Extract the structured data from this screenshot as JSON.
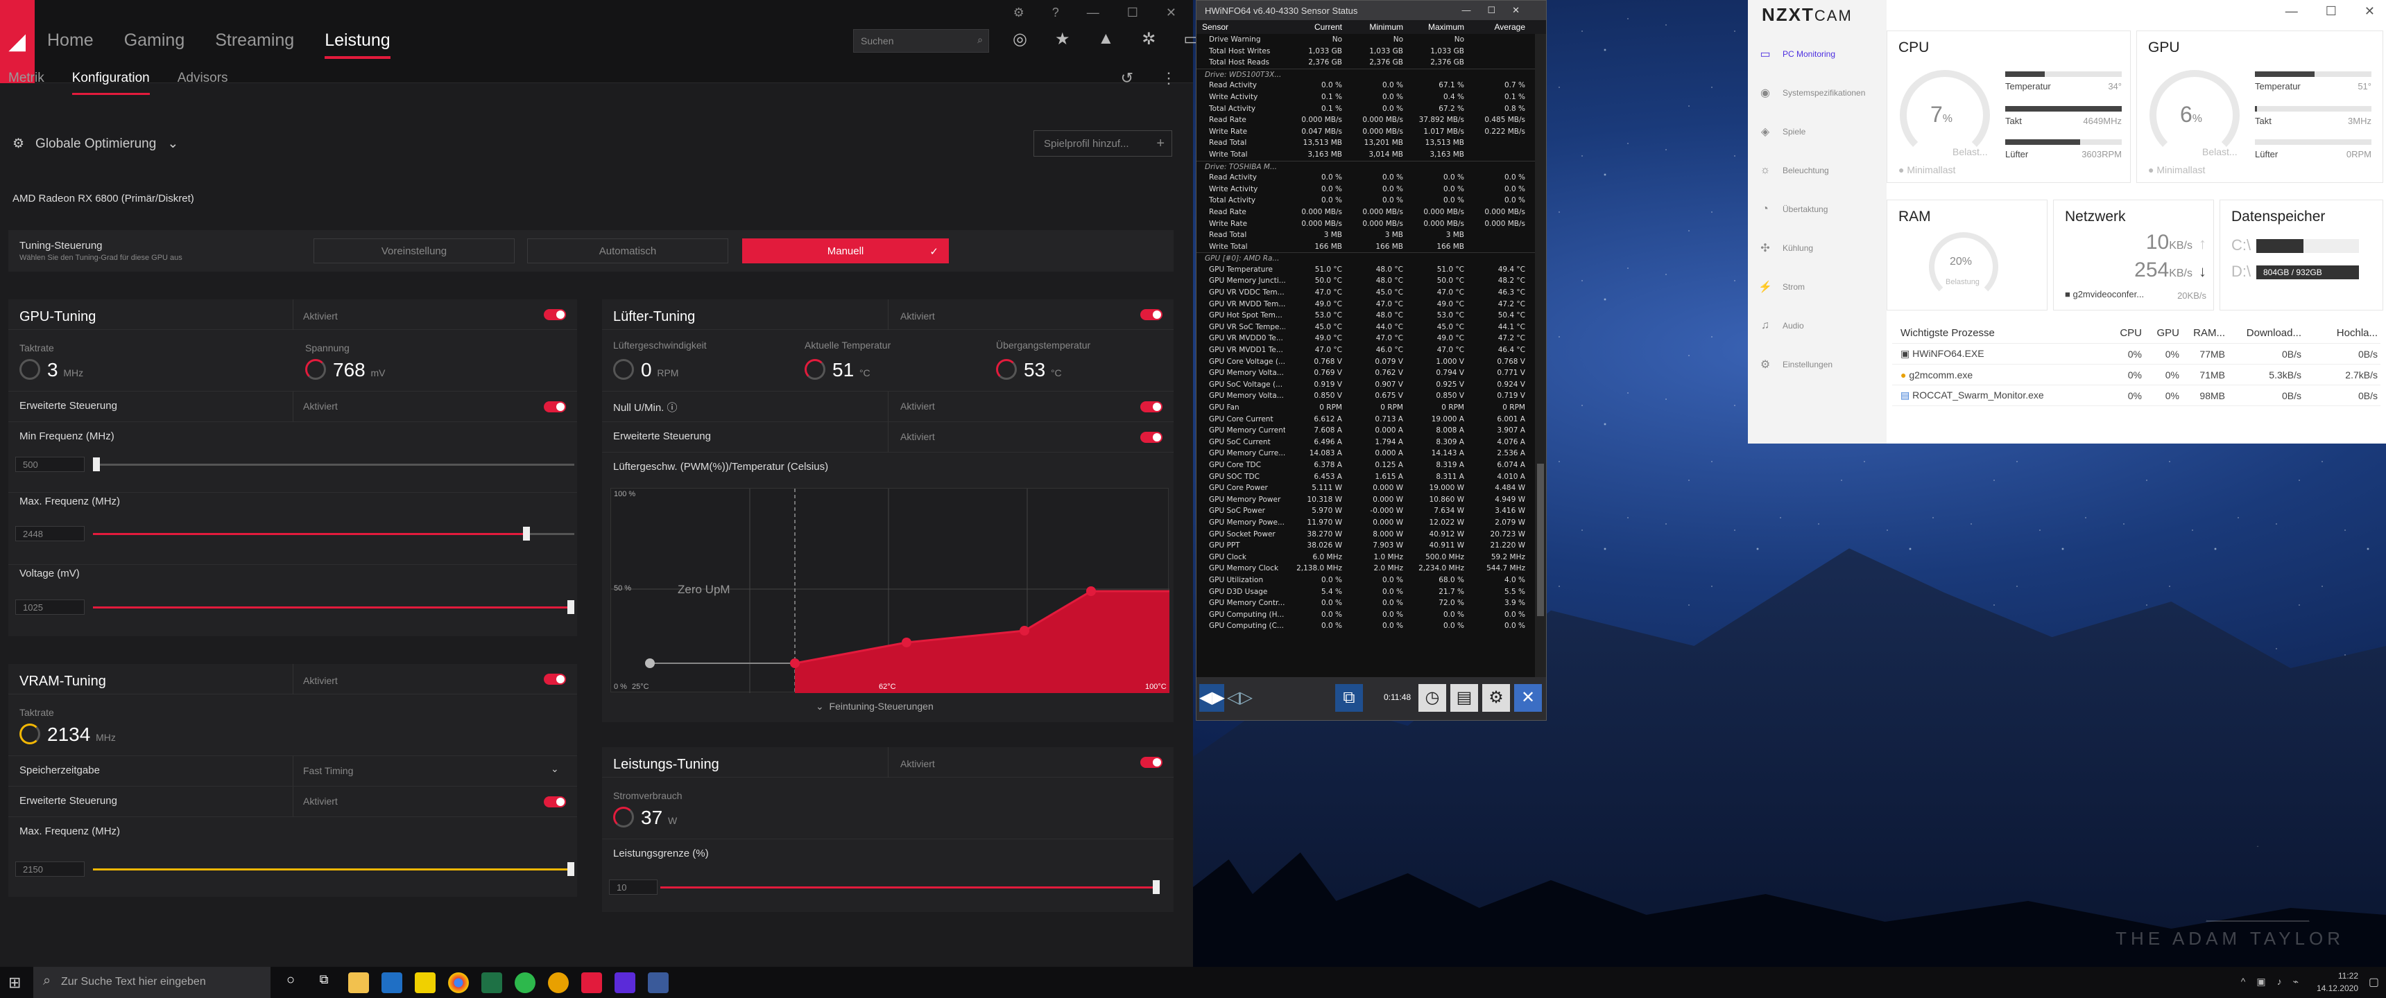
{
  "amd": {
    "nav": [
      "Home",
      "Gaming",
      "Streaming",
      "Leistung"
    ],
    "nav_active": "Leistung",
    "search_placeholder": "Suchen",
    "subnav": [
      "Metrik",
      "Konfiguration",
      "Advisors"
    ],
    "opt_label": "Globale Optimierung",
    "spielprofil": "Spielprofil hinzuf...",
    "gpu_name": "AMD Radeon RX 6800 (Primär/Diskret)",
    "tuning": {
      "title": "Tuning-Steuerung",
      "sub": "Wählen Sie den Tuning-Grad für diese GPU aus",
      "opts": [
        "Voreinstellung",
        "Automatisch",
        "Manuell"
      ]
    },
    "gpu": {
      "title": "GPU-Tuning",
      "status": "Aktiviert",
      "taktrate_label": "Taktrate",
      "taktrate": "3",
      "taktrate_unit": "MHz",
      "spannung_label": "Spannung",
      "spannung": "768",
      "spannung_unit": "mV",
      "erw": "Erweiterte Steuerung",
      "erw_status": "Aktiviert",
      "min_label": "Min Frequenz (MHz)",
      "min_val": "500",
      "max_label": "Max. Frequenz (MHz)",
      "max_val": "2448",
      "volt_label": "Voltage (mV)",
      "volt_val": "1025"
    },
    "vram": {
      "title": "VRAM-Tuning",
      "status": "Aktiviert",
      "taktrate_label": "Taktrate",
      "taktrate": "2134",
      "taktrate_unit": "MHz",
      "zeit_label": "Speicherzeitgabe",
      "zeit_val": "Fast Timing",
      "erw": "Erweiterte Steuerung",
      "erw_status": "Aktiviert",
      "max_label": "Max. Frequenz (MHz)",
      "max_val": "2150"
    },
    "fan": {
      "title": "Lüfter-Tuning",
      "status": "Aktiviert",
      "speed_label": "Lüftergeschwindigkeit",
      "speed": "0",
      "speed_unit": "RPM",
      "temp_label": "Aktuelle Temperatur",
      "temp": "51",
      "temp_unit": "°C",
      "jt_label": "Übergangstemperatur",
      "jt": "53",
      "jt_unit": "°C",
      "null_label": "Null U/Min.",
      "null_status": "Aktiviert",
      "erw": "Erweiterte Steuerung",
      "erw_status": "Aktiviert",
      "chart_title": "Lüftergeschw. (PWM(%))/Temperatur (Celsius)",
      "y100": "100 %",
      "y50": "50 %",
      "y0": "0 %",
      "x25": "25°C",
      "x62": "62°C",
      "x100": "100°C",
      "zero": "Zero UpM",
      "fein": "Feintuning-Steuerungen"
    },
    "power": {
      "title": "Leistungs-Tuning",
      "status": "Aktiviert",
      "strom_label": "Stromverbrauch",
      "strom": "37",
      "strom_unit": "W",
      "grenze_label": "Leistungsgrenze (%)",
      "grenze_val": "10"
    }
  },
  "hwinfo": {
    "title": "HWiNFO64 v6.40-4330 Sensor Status",
    "cols": [
      "Sensor",
      "Current",
      "Minimum",
      "Maximum",
      "Average"
    ],
    "time": "0:11:48",
    "rows": [
      [
        "Drive Warning",
        "No",
        "No",
        "No",
        ""
      ],
      [
        "Total Host Writes",
        "1,033 GB",
        "1,033 GB",
        "1,033 GB",
        ""
      ],
      [
        "Total Host Reads",
        "2,376 GB",
        "2,376 GB",
        "2,376 GB",
        ""
      ],
      [
        "#Drive: WDS100T3X...",
        "",
        "",
        "",
        ""
      ],
      [
        "Read Activity",
        "0.0 %",
        "0.0 %",
        "67.1 %",
        "0.7 %"
      ],
      [
        "Write Activity",
        "0.1 %",
        "0.0 %",
        "0.4 %",
        "0.1 %"
      ],
      [
        "Total Activity",
        "0.1 %",
        "0.0 %",
        "67.2 %",
        "0.8 %"
      ],
      [
        "Read Rate",
        "0.000 MB/s",
        "0.000 MB/s",
        "37.892 MB/s",
        "0.485 MB/s"
      ],
      [
        "Write Rate",
        "0.047 MB/s",
        "0.000 MB/s",
        "1.017 MB/s",
        "0.222 MB/s"
      ],
      [
        "Read Total",
        "13,513 MB",
        "13,201 MB",
        "13,513 MB",
        ""
      ],
      [
        "Write Total",
        "3,163 MB",
        "3,014 MB",
        "3,163 MB",
        ""
      ],
      [
        "#Drive: TOSHIBA M...",
        "",
        "",
        "",
        ""
      ],
      [
        "Read Activity",
        "0.0 %",
        "0.0 %",
        "0.0 %",
        "0.0 %"
      ],
      [
        "Write Activity",
        "0.0 %",
        "0.0 %",
        "0.0 %",
        "0.0 %"
      ],
      [
        "Total Activity",
        "0.0 %",
        "0.0 %",
        "0.0 %",
        "0.0 %"
      ],
      [
        "Read Rate",
        "0.000 MB/s",
        "0.000 MB/s",
        "0.000 MB/s",
        "0.000 MB/s"
      ],
      [
        "Write Rate",
        "0.000 MB/s",
        "0.000 MB/s",
        "0.000 MB/s",
        "0.000 MB/s"
      ],
      [
        "Read Total",
        "3 MB",
        "3 MB",
        "3 MB",
        ""
      ],
      [
        "Write Total",
        "166 MB",
        "166 MB",
        "166 MB",
        ""
      ],
      [
        "#GPU [#0]: AMD Ra...",
        "",
        "",
        "",
        ""
      ],
      [
        "GPU Temperature",
        "51.0 °C",
        "48.0 °C",
        "51.0 °C",
        "49.4 °C"
      ],
      [
        "GPU Memory Juncti...",
        "50.0 °C",
        "48.0 °C",
        "50.0 °C",
        "48.2 °C"
      ],
      [
        "GPU VR VDDC Tem...",
        "47.0 °C",
        "45.0 °C",
        "47.0 °C",
        "46.3 °C"
      ],
      [
        "GPU VR MVDD Tem...",
        "49.0 °C",
        "47.0 °C",
        "49.0 °C",
        "47.2 °C"
      ],
      [
        "GPU Hot Spot Tem...",
        "53.0 °C",
        "48.0 °C",
        "53.0 °C",
        "50.4 °C"
      ],
      [
        "GPU VR SoC Tempe...",
        "45.0 °C",
        "44.0 °C",
        "45.0 °C",
        "44.1 °C"
      ],
      [
        "GPU VR MVDD0 Te...",
        "49.0 °C",
        "47.0 °C",
        "49.0 °C",
        "47.2 °C"
      ],
      [
        "GPU VR MVDD1 Te...",
        "47.0 °C",
        "46.0 °C",
        "47.0 °C",
        "46.4 °C"
      ],
      [
        "GPU Core Voltage (...",
        "0.768 V",
        "0.079 V",
        "1.000 V",
        "0.768 V"
      ],
      [
        "GPU Memory Volta...",
        "0.769 V",
        "0.762 V",
        "0.794 V",
        "0.771 V"
      ],
      [
        "GPU SoC Voltage (...",
        "0.919 V",
        "0.907 V",
        "0.925 V",
        "0.924 V"
      ],
      [
        "GPU Memory Volta...",
        "0.850 V",
        "0.675 V",
        "0.850 V",
        "0.719 V"
      ],
      [
        "GPU Fan",
        "0 RPM",
        "0 RPM",
        "0 RPM",
        "0 RPM"
      ],
      [
        "GPU Core Current",
        "6.612 A",
        "0.713 A",
        "19.000 A",
        "6.001 A"
      ],
      [
        "GPU Memory Current",
        "7.608 A",
        "0.000 A",
        "8.008 A",
        "3.907 A"
      ],
      [
        "GPU SoC Current",
        "6.496 A",
        "1.794 A",
        "8.309 A",
        "4.076 A"
      ],
      [
        "GPU Memory Curre...",
        "14.083 A",
        "0.000 A",
        "14.143 A",
        "2.536 A"
      ],
      [
        "GPU Core TDC",
        "6.378 A",
        "0.125 A",
        "8.319 A",
        "6.074 A"
      ],
      [
        "GPU SOC TDC",
        "6.453 A",
        "1.615 A",
        "8.311 A",
        "4.010 A"
      ],
      [
        "GPU Core Power",
        "5.111 W",
        "0.000 W",
        "19.000 W",
        "4.484 W"
      ],
      [
        "GPU Memory Power",
        "10.318 W",
        "0.000 W",
        "10.860 W",
        "4.949 W"
      ],
      [
        "GPU SoC Power",
        "5.970 W",
        "-0.000 W",
        "7.634 W",
        "3.416 W"
      ],
      [
        "GPU Memory Powe...",
        "11.970 W",
        "0.000 W",
        "12.022 W",
        "2.079 W"
      ],
      [
        "GPU Socket Power",
        "38.270 W",
        "8.000 W",
        "40.912 W",
        "20.723 W"
      ],
      [
        "GPU PPT",
        "38.026 W",
        "7.903 W",
        "40.911 W",
        "21.220 W"
      ],
      [
        "GPU Clock",
        "6.0 MHz",
        "1.0 MHz",
        "500.0 MHz",
        "59.2 MHz"
      ],
      [
        "GPU Memory Clock",
        "2,138.0 MHz",
        "2.0 MHz",
        "2,234.0 MHz",
        "544.7 MHz"
      ],
      [
        "GPU Utilization",
        "0.0 %",
        "0.0 %",
        "68.0 %",
        "4.0 %"
      ],
      [
        "GPU D3D Usage",
        "5.4 %",
        "0.0 %",
        "21.7 %",
        "5.5 %"
      ],
      [
        "GPU Memory Contr...",
        "0.0 %",
        "0.0 %",
        "72.0 %",
        "3.9 %"
      ],
      [
        "GPU Computing (H...",
        "0.0 %",
        "0.0 %",
        "0.0 %",
        "0.0 %"
      ],
      [
        "GPU Computing (C...",
        "0.0 %",
        "0.0 %",
        "0.0 %",
        "0.0 %"
      ]
    ]
  },
  "nzxt": {
    "logo": "NZXT",
    "logo2": "CAM",
    "nav": [
      "PC Monitoring",
      "Systemspezifikationen",
      "Spiele",
      "Beleuchtung",
      "Übertaktung",
      "Kühlung",
      "Strom",
      "Audio",
      "Einstellungen"
    ],
    "cpu": {
      "title": "CPU",
      "load": "7",
      "load_unit": "%",
      "sub": "Belast...",
      "mode": "Minimallast",
      "temp_label": "Temperatur",
      "temp": "34°",
      "takt_label": "Takt",
      "takt": "4649MHz",
      "fan_label": "Lüfter",
      "fan": "3603RPM"
    },
    "gpu": {
      "title": "GPU",
      "load": "6",
      "load_unit": "%",
      "sub": "Belast...",
      "mode": "Minimallast",
      "temp_label": "Temperatur",
      "temp": "51°",
      "takt_label": "Takt",
      "takt": "3MHz",
      "fan_label": "Lüfter",
      "fan": "0RPM"
    },
    "ram": {
      "title": "RAM",
      "load": "20%",
      "sub": "Belastung"
    },
    "net": {
      "title": "Netzwerk",
      "up": "10",
      "up_unit": "KB/s",
      "down": "254",
      "down_unit": "KB/s",
      "proc": "g2mvideoconfer...",
      "proc_val": "20KB/s"
    },
    "disk": {
      "title": "Datenspeicher",
      "c": "C:\\",
      "c_val": "",
      "d": "D:\\",
      "d_val": "804GB / 932GB"
    },
    "proc_head": [
      "Wichtigste Prozesse",
      "CPU",
      "GPU",
      "RAM...",
      "Download...",
      "Hochla..."
    ],
    "procs": [
      [
        "HWiNFO64.EXE",
        "0%",
        "0%",
        "77MB",
        "0B/s",
        "0B/s"
      ],
      [
        "g2mcomm.exe",
        "0%",
        "0%",
        "71MB",
        "5.3kB/s",
        "2.7kB/s"
      ],
      [
        "ROCCAT_Swarm_Monitor.exe",
        "0%",
        "0%",
        "98MB",
        "0B/s",
        "0B/s"
      ]
    ]
  },
  "taskbar": {
    "search": "Zur Suche Text hier eingeben",
    "time": "11:22",
    "date": "14.12.2020"
  },
  "watermark": "THE ADAM TAYLOR"
}
